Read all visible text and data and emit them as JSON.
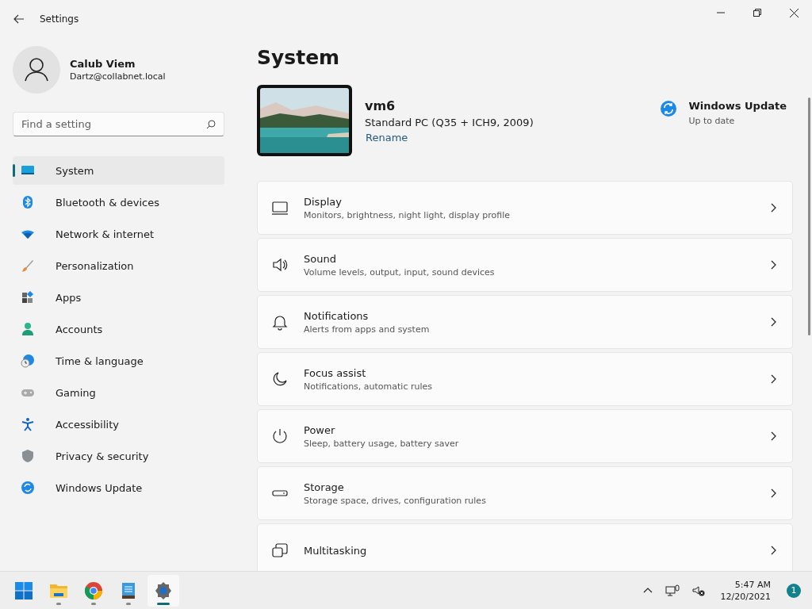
{
  "window": {
    "title": "Settings"
  },
  "profile": {
    "name": "Calub Viem",
    "email": "Dartz@collabnet.local"
  },
  "search": {
    "placeholder": "Find a setting"
  },
  "sidebar": {
    "items": [
      {
        "label": "System",
        "selected": true
      },
      {
        "label": "Bluetooth & devices",
        "selected": false
      },
      {
        "label": "Network & internet",
        "selected": false
      },
      {
        "label": "Personalization",
        "selected": false
      },
      {
        "label": "Apps",
        "selected": false
      },
      {
        "label": "Accounts",
        "selected": false
      },
      {
        "label": "Time & language",
        "selected": false
      },
      {
        "label": "Gaming",
        "selected": false
      },
      {
        "label": "Accessibility",
        "selected": false
      },
      {
        "label": "Privacy & security",
        "selected": false
      },
      {
        "label": "Windows Update",
        "selected": false
      }
    ]
  },
  "page_title": "System",
  "device": {
    "name": "vm6",
    "model": "Standard PC (Q35 + ICH9, 2009)",
    "rename": "Rename"
  },
  "update": {
    "title": "Windows Update",
    "status": "Up to date"
  },
  "settings": [
    {
      "title": "Display",
      "subtitle": "Monitors, brightness, night light, display profile"
    },
    {
      "title": "Sound",
      "subtitle": "Volume levels, output, input, sound devices"
    },
    {
      "title": "Notifications",
      "subtitle": "Alerts from apps and system"
    },
    {
      "title": "Focus assist",
      "subtitle": "Notifications, automatic rules"
    },
    {
      "title": "Power",
      "subtitle": "Sleep, battery usage, battery saver"
    },
    {
      "title": "Storage",
      "subtitle": "Storage space, drives, configuration rules"
    },
    {
      "title": "Multitasking"
    }
  ],
  "taskbar": {
    "apps": [
      {
        "kind": "start",
        "running": false,
        "selected": false
      },
      {
        "kind": "explorer",
        "running": true,
        "selected": false
      },
      {
        "kind": "chrome",
        "running": true,
        "selected": false
      },
      {
        "kind": "notepad",
        "running": true,
        "selected": false
      },
      {
        "kind": "settings",
        "running": true,
        "selected": true
      }
    ],
    "time": "5:47 AM",
    "date": "12/20/2021",
    "notifications": "1"
  }
}
